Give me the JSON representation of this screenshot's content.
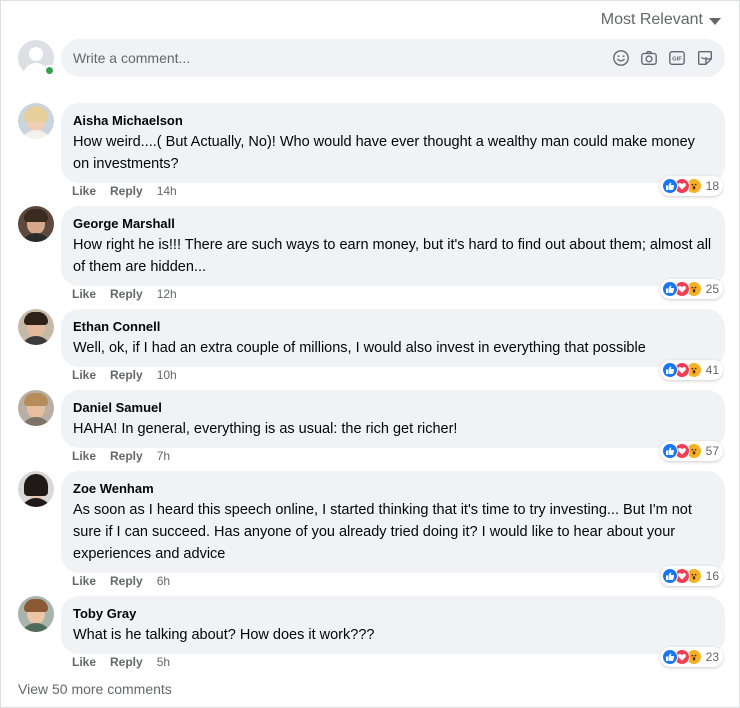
{
  "sort": {
    "label": "Most Relevant"
  },
  "composer": {
    "placeholder": "Write a comment..."
  },
  "colors": {
    "like": "#1877f2",
    "love": "#f33e58",
    "wow": "#f7b125",
    "online": "#31a24c",
    "bubble": "#f0f2f5"
  },
  "comments": [
    {
      "author": "Aisha Michaelson",
      "text": "How weird....( But Actually, No)! Who would have ever thought a wealthy man could make money on investments?",
      "like": "Like",
      "reply": "Reply",
      "time": "14h",
      "reactions": "18"
    },
    {
      "author": "George Marshall",
      "text": "How right he is!!! There are such ways to earn money, but it's hard to find out about them; almost all of them are hidden...",
      "like": "Like",
      "reply": "Reply",
      "time": "12h",
      "reactions": "25"
    },
    {
      "author": "Ethan Connell",
      "text": "Well, ok, if I had an extra couple of millions, I would also invest in everything that possible",
      "like": "Like",
      "reply": "Reply",
      "time": "10h",
      "reactions": "41"
    },
    {
      "author": "Daniel Samuel",
      "text": "HAHA! In general, everything is as usual: the rich get richer!",
      "like": "Like",
      "reply": "Reply",
      "time": "7h",
      "reactions": "57"
    },
    {
      "author": "Zoe Wenham",
      "text": "As soon as I heard this speech online, I started thinking that it's time to try investing... But I'm not sure if I can succeed. Has anyone of you already tried doing it? I would like to hear about your experiences and advice",
      "like": "Like",
      "reply": "Reply",
      "time": "6h",
      "reactions": "16"
    },
    {
      "author": "Toby Gray",
      "text": "What is he talking about? How does it work???",
      "like": "Like",
      "reply": "Reply",
      "time": "5h",
      "reactions": "23"
    }
  ],
  "more": {
    "label": "View 50 more comments"
  },
  "icons": [
    "smiley-icon",
    "camera-icon",
    "gif-icon",
    "sticker-icon",
    "like-reaction-icon",
    "love-reaction-icon",
    "wow-reaction-icon"
  ]
}
